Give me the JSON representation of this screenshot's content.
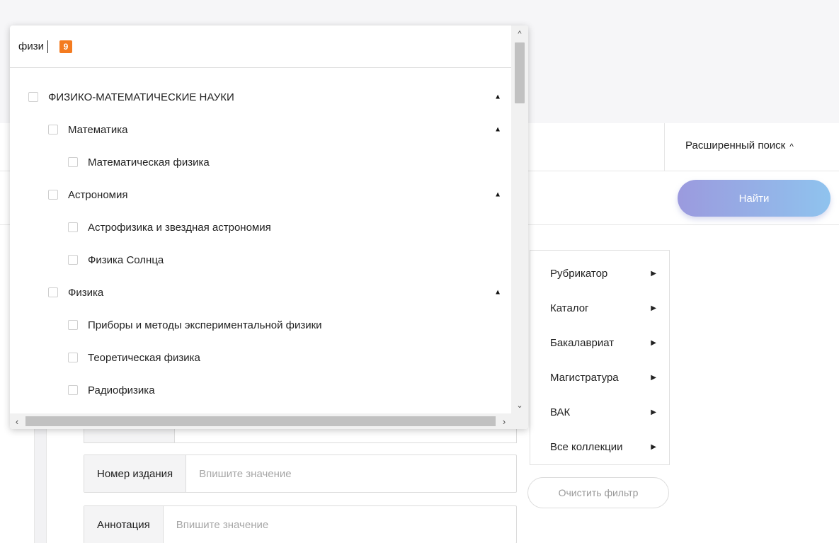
{
  "popup": {
    "search_value": "физи",
    "result_count": "9",
    "tree": [
      {
        "label": "ФИЗИКО-МАТЕМАТИЧЕСКИЕ НАУКИ",
        "level": 0,
        "expanded": true
      },
      {
        "label": "Математика",
        "level": 1,
        "expanded": true
      },
      {
        "label": "Математическая физика",
        "level": 2
      },
      {
        "label": "Астрономия",
        "level": 1,
        "expanded": true
      },
      {
        "label": "Астрофизика и звездная астрономия",
        "level": 2
      },
      {
        "label": "Физика Солнца",
        "level": 2
      },
      {
        "label": "Физика",
        "level": 1,
        "expanded": true
      },
      {
        "label": "Приборы и методы экспериментальной физики",
        "level": 2
      },
      {
        "label": "Теоретическая физика",
        "level": 2
      },
      {
        "label": "Радиофизика",
        "level": 2
      }
    ],
    "icons": {
      "expanded": "triangle-up-icon"
    }
  },
  "header": {
    "advanced_search_label": "Расширенный поиск",
    "find_button_label": "Найти"
  },
  "side_menu": {
    "items": [
      {
        "label": "Рубрикатор"
      },
      {
        "label": "Каталог"
      },
      {
        "label": "Бакалавриат"
      },
      {
        "label": "Магистратура"
      },
      {
        "label": "ВАК"
      },
      {
        "label": "Все коллекции"
      }
    ],
    "clear_filter_label": "Очистить фильтр"
  },
  "fields": [
    {
      "label": "Номер издания",
      "placeholder": "Впишите значение",
      "value": ""
    },
    {
      "label": "Аннотация",
      "placeholder": "Впишите значение",
      "value": ""
    }
  ],
  "colors": {
    "badge": "#f47b20",
    "find_gradient_start": "#9b9ade",
    "find_gradient_end": "#8fc3ee"
  }
}
